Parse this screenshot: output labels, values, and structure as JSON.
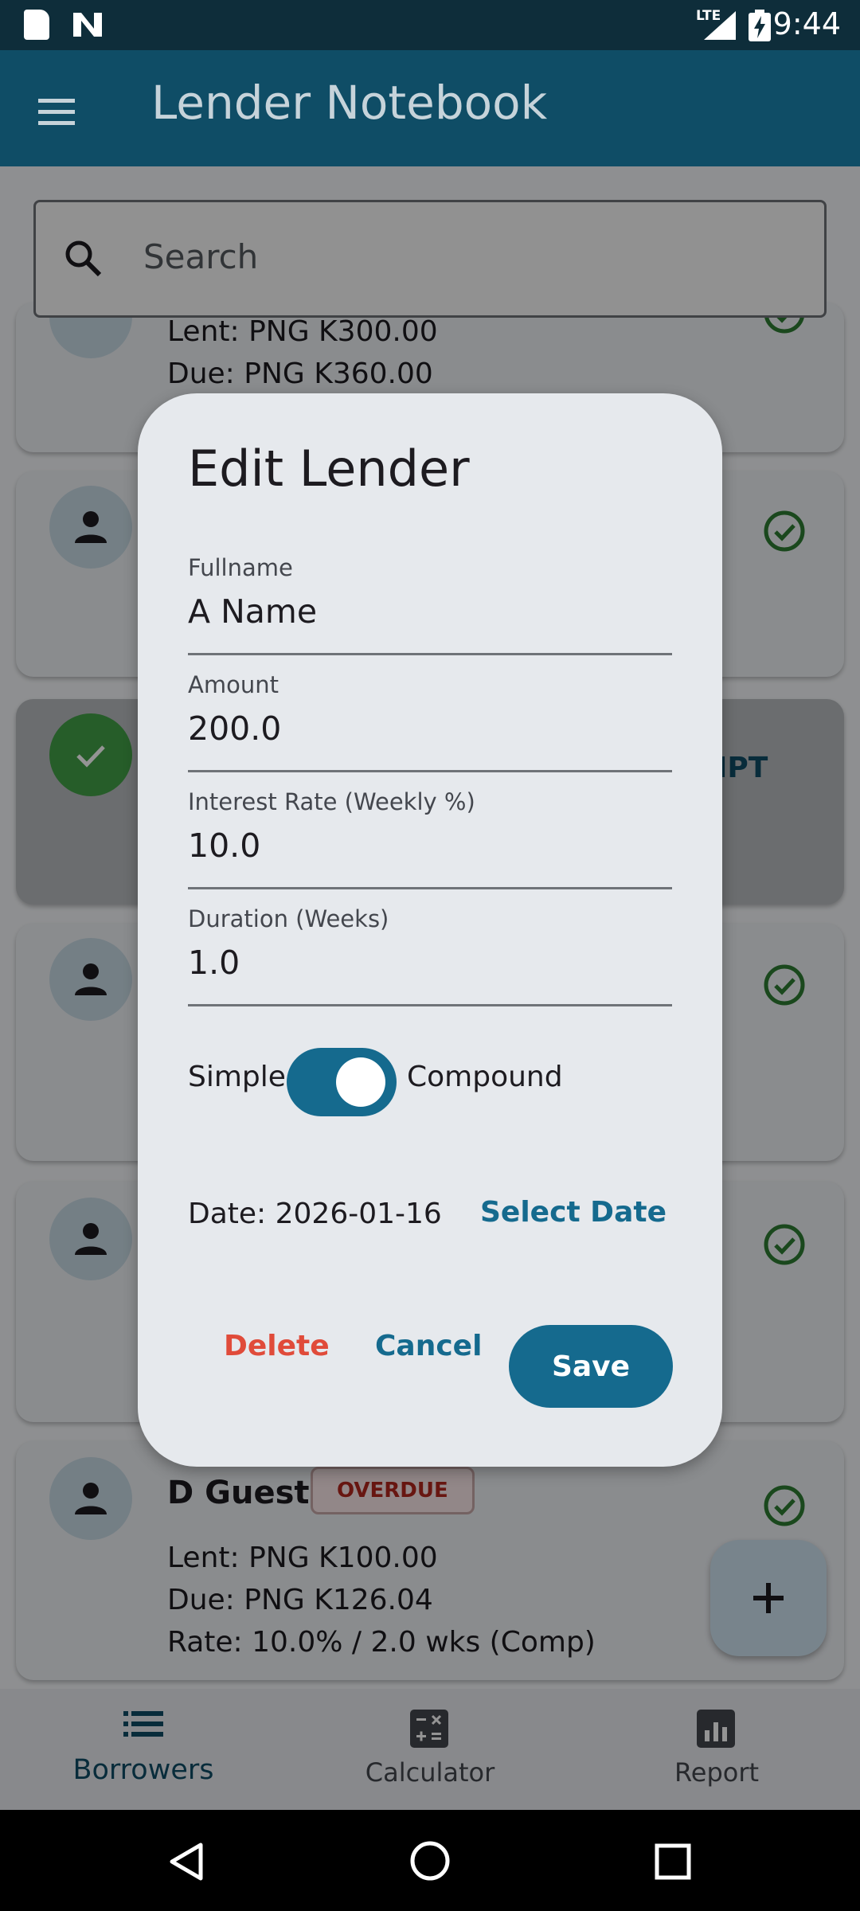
{
  "status_bar": {
    "network": "LTE",
    "time": "9:44"
  },
  "app_bar": {
    "title": "Lender Notebook"
  },
  "search": {
    "placeholder": "Search"
  },
  "cards": [
    {
      "lent": "Lent: PNG K300.00",
      "due": "Due: PNG K360.00",
      "status": "paid"
    },
    {
      "status": "paid"
    },
    {
      "status": "receipt",
      "partial_label": "IPT"
    },
    {
      "status": "paid"
    },
    {
      "status": "paid"
    },
    {
      "name": "D Guest",
      "badge": "OVERDUE",
      "lent": "Lent: PNG K100.00",
      "due": "Due: PNG K126.04",
      "rate": "Rate: 10.0% / 2.0 wks (Comp)",
      "status": "paid"
    }
  ],
  "bottom_nav": {
    "items": [
      {
        "label": "Borrowers",
        "icon": "list-icon",
        "active": true
      },
      {
        "label": "Calculator",
        "icon": "calculator-icon",
        "active": false
      },
      {
        "label": "Report",
        "icon": "bar-chart-icon",
        "active": false
      }
    ]
  },
  "dialog": {
    "title": "Edit Lender",
    "fields": [
      {
        "label": "Fullname",
        "value": "A Name"
      },
      {
        "label": "Amount",
        "value": "200.0"
      },
      {
        "label": "Interest Rate (Weekly %)",
        "value": "10.0"
      },
      {
        "label": "Duration (Weeks)",
        "value": "1.0"
      }
    ],
    "toggle": {
      "left_label": "Simple",
      "right_label": "Compound",
      "on": true
    },
    "date_text": "Date: 2026-01-16",
    "select_date_label": "Select Date",
    "delete_label": "Delete",
    "cancel_label": "Cancel",
    "save_label": "Save"
  },
  "colors": {
    "primary": "#156a8e",
    "app_bar": "#0f4d66",
    "danger": "#e04b3a",
    "success": "#2e7d32"
  }
}
